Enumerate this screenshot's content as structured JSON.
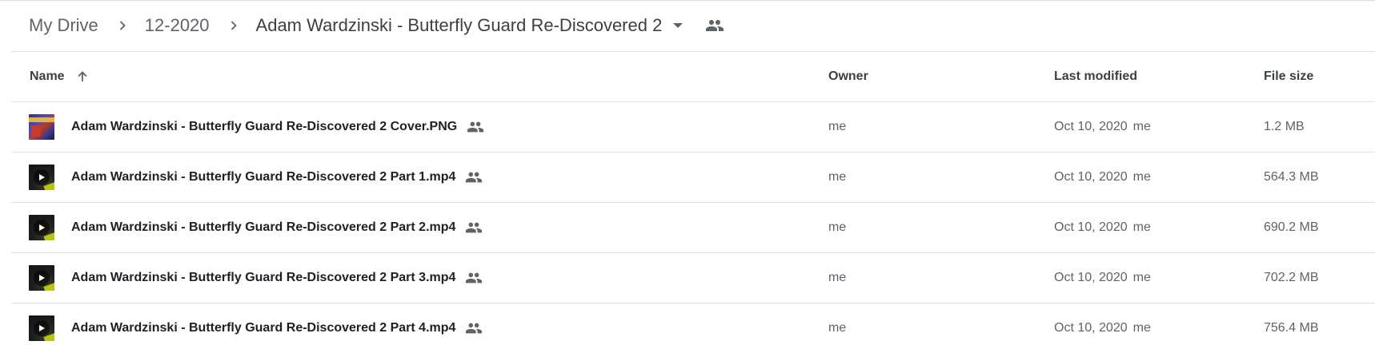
{
  "breadcrumb": {
    "items": [
      {
        "label": "My Drive"
      },
      {
        "label": "12-2020"
      },
      {
        "label": "Adam Wardzinski - Butterfly Guard Re-Discovered 2"
      }
    ],
    "separator_icon": "chevron-right-icon",
    "dropdown_icon": "arrow-drop-down-icon",
    "shared_icon": "people-icon"
  },
  "table": {
    "columns": {
      "name": "Name",
      "owner": "Owner",
      "last_modified": "Last modified",
      "file_size": "File size"
    },
    "sort": {
      "column": "name",
      "direction": "ascending",
      "icon": "arrow-upward-icon"
    },
    "rows": [
      {
        "name": "Adam Wardzinski - Butterfly Guard Re-Discovered 2 Cover.PNG",
        "type": "image",
        "owner": "me",
        "modified_date": "Oct 10, 2020",
        "modified_by": "me",
        "size": "1.2 MB",
        "shared": true
      },
      {
        "name": "Adam Wardzinski - Butterfly Guard Re-Discovered 2 Part 1.mp4",
        "type": "video",
        "owner": "me",
        "modified_date": "Oct 10, 2020",
        "modified_by": "me",
        "size": "564.3 MB",
        "shared": true
      },
      {
        "name": "Adam Wardzinski - Butterfly Guard Re-Discovered 2 Part 2.mp4",
        "type": "video",
        "owner": "me",
        "modified_date": "Oct 10, 2020",
        "modified_by": "me",
        "size": "690.2 MB",
        "shared": true
      },
      {
        "name": "Adam Wardzinski - Butterfly Guard Re-Discovered 2 Part 3.mp4",
        "type": "video",
        "owner": "me",
        "modified_date": "Oct 10, 2020",
        "modified_by": "me",
        "size": "702.2 MB",
        "shared": true
      },
      {
        "name": "Adam Wardzinski - Butterfly Guard Re-Discovered 2 Part 4.mp4",
        "type": "video",
        "owner": "me",
        "modified_date": "Oct 10, 2020",
        "modified_by": "me",
        "size": "756.4 MB",
        "shared": true
      }
    ]
  },
  "colors": {
    "text_primary": "#202124",
    "text_secondary": "#5f6368",
    "divider": "#e0e0e0",
    "icon": "#5f6368"
  }
}
